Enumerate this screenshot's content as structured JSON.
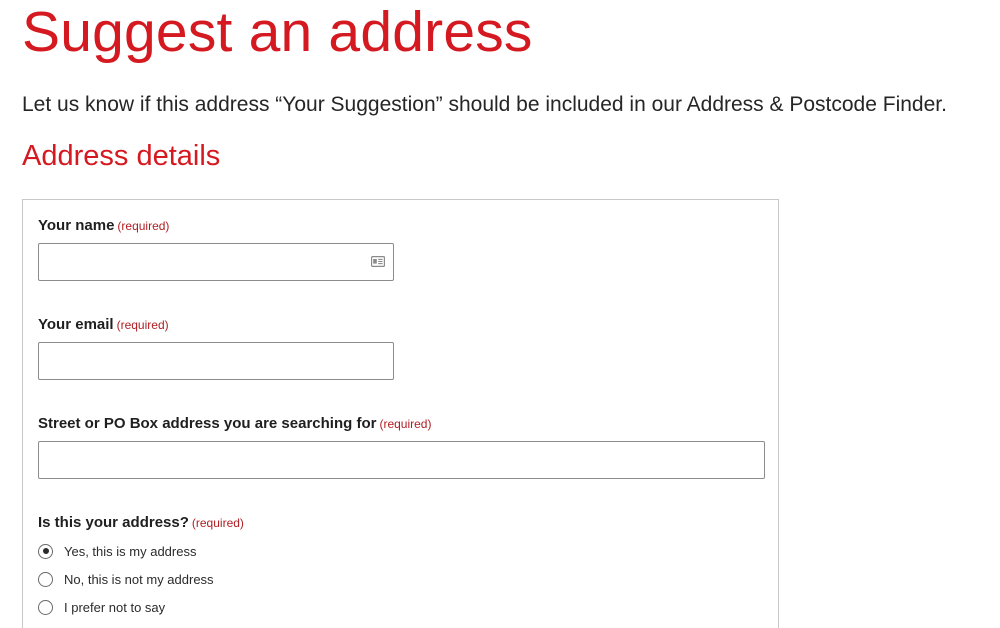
{
  "page": {
    "title": "Suggest an address",
    "intro": "Let us know if this address “Your Suggestion” should be included in our Address & Postcode Finder.",
    "section_heading": "Address details"
  },
  "form": {
    "required_text": "(required)",
    "name": {
      "label": "Your name",
      "value": "",
      "icon": "contact-card-icon"
    },
    "email": {
      "label": "Your email",
      "value": ""
    },
    "street": {
      "label": "Street or PO Box address you are searching for",
      "value": ""
    },
    "is_your_address": {
      "label": "Is this your address?",
      "options": [
        {
          "label": "Yes, this is my address",
          "selected": true
        },
        {
          "label": "No, this is not my address",
          "selected": false
        },
        {
          "label": "I prefer not to say",
          "selected": false
        }
      ]
    }
  },
  "colors": {
    "brand_red": "#d51920",
    "required_red": "#b01e23",
    "text": "#262626",
    "border": "#c8c8c8"
  }
}
